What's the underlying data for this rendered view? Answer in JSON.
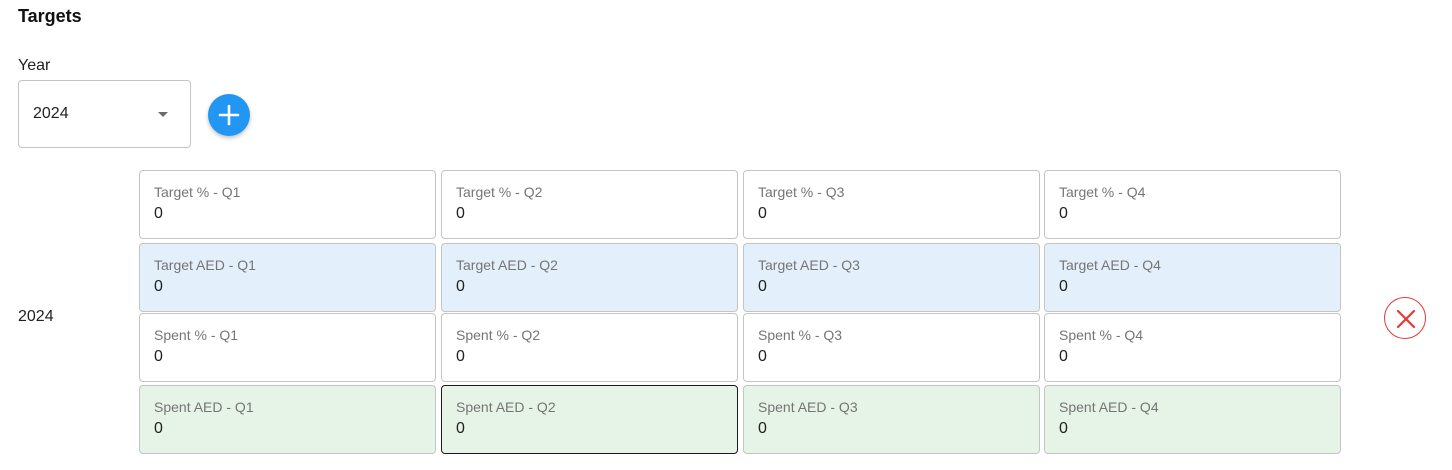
{
  "section": {
    "title": "Targets"
  },
  "year_picker": {
    "label": "Year",
    "selected": "2024"
  },
  "target_row": {
    "year": "2024",
    "fields": [
      [
        {
          "label": "Target % - Q1",
          "value": "0"
        },
        {
          "label": "Target % - Q2",
          "value": "0"
        },
        {
          "label": "Target % - Q3",
          "value": "0"
        },
        {
          "label": "Target % - Q4",
          "value": "0"
        }
      ],
      [
        {
          "label": "Target AED - Q1",
          "value": "0"
        },
        {
          "label": "Target AED - Q2",
          "value": "0"
        },
        {
          "label": "Target AED - Q3",
          "value": "0"
        },
        {
          "label": "Target AED - Q4",
          "value": "0"
        }
      ],
      [
        {
          "label": "Spent % - Q1",
          "value": "0"
        },
        {
          "label": "Spent % - Q2",
          "value": "0"
        },
        {
          "label": "Spent % - Q3",
          "value": "0"
        },
        {
          "label": "Spent % - Q4",
          "value": "0"
        }
      ],
      [
        {
          "label": "Spent AED - Q1",
          "value": "0"
        },
        {
          "label": "Spent AED - Q2",
          "value": "0"
        },
        {
          "label": "Spent AED - Q3",
          "value": "0"
        },
        {
          "label": "Spent AED - Q4",
          "value": "0"
        }
      ]
    ]
  },
  "icons": {
    "add": "plus-icon",
    "remove": "close-circle-icon",
    "dropdown": "caret-down-icon"
  },
  "colors": {
    "accent": "#2196f3",
    "danger": "#e53935",
    "target_aed_bg": "#e3f0fb",
    "spent_aed_bg": "#e6f4e7"
  }
}
